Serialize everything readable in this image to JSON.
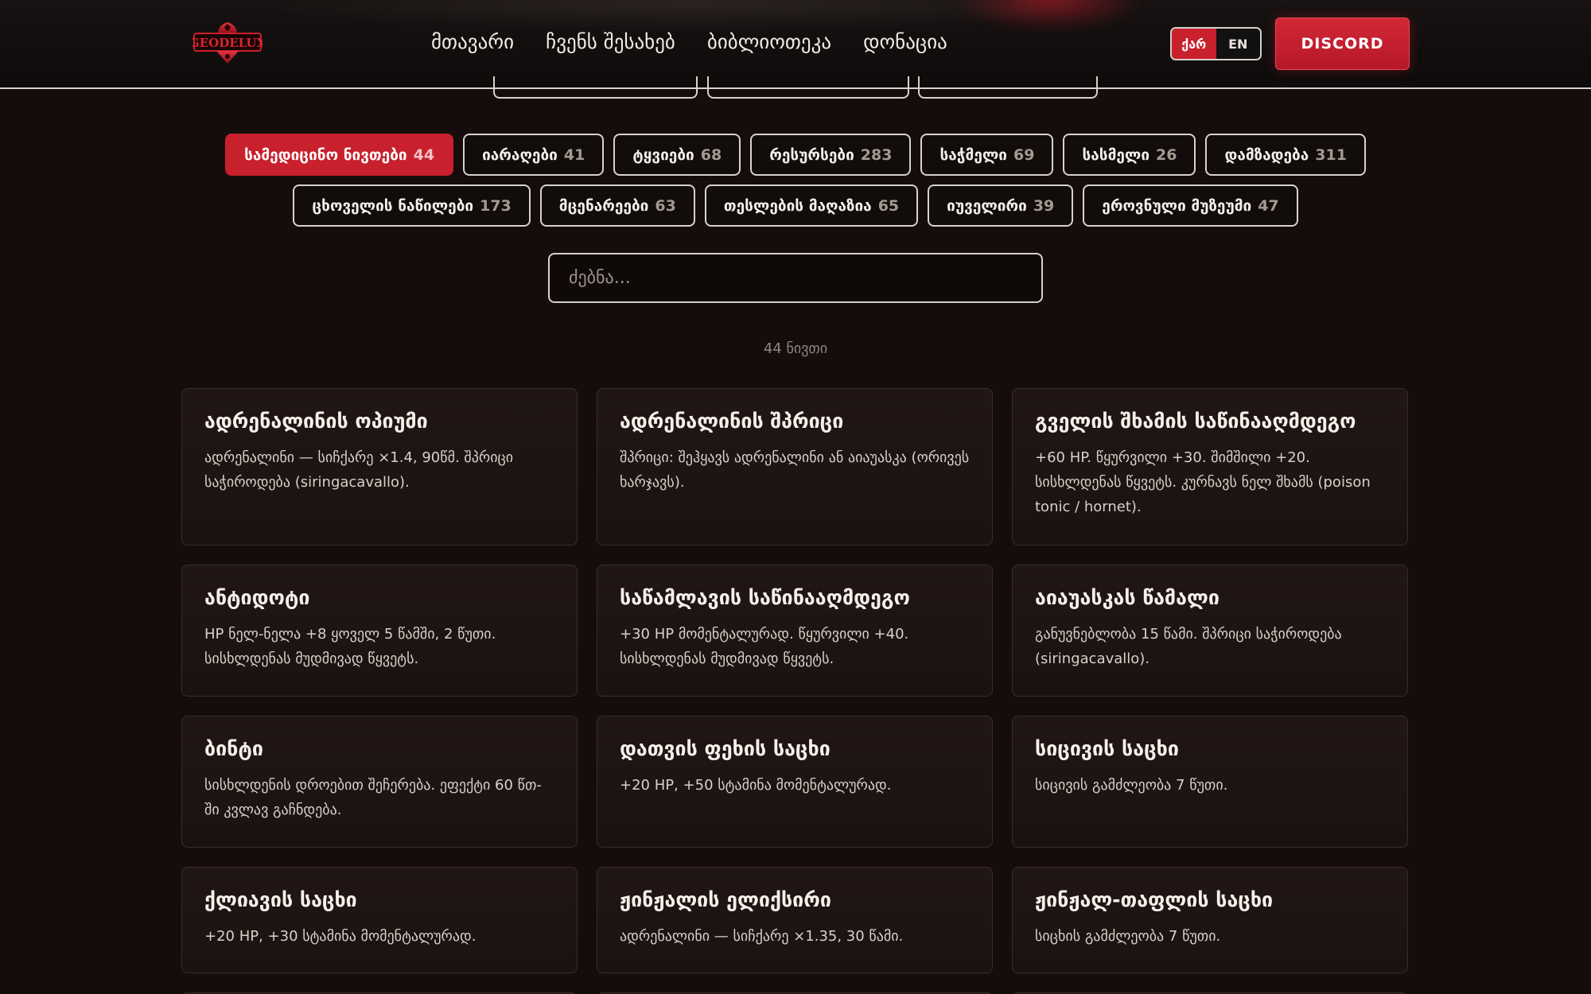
{
  "brand": {
    "logo_text": "GEODELUX"
  },
  "nav": [
    {
      "label": "მთავარი"
    },
    {
      "label": "ჩვენს შესახებ"
    },
    {
      "label": "ბიბლიოთეკა"
    },
    {
      "label": "დონაცია"
    }
  ],
  "lang": {
    "ka": "ქარ",
    "en": "EN",
    "active": "ka"
  },
  "discord_label": "DISCORD",
  "colors": {
    "accent": "#c8202d",
    "background": "#150d0c",
    "card": "#1f1514"
  },
  "categories_row1": [
    {
      "label": "სამედიცინო ნივთები",
      "count": "44",
      "active": true
    },
    {
      "label": "იარაღები",
      "count": "41"
    },
    {
      "label": "ტყვიები",
      "count": "68"
    },
    {
      "label": "რესურსები",
      "count": "283"
    },
    {
      "label": "საჭმელი",
      "count": "69"
    },
    {
      "label": "სასმელი",
      "count": "26"
    },
    {
      "label": "დამზადება",
      "count": "311"
    }
  ],
  "categories_row2": [
    {
      "label": "ცხოველის ნაწილები",
      "count": "173"
    },
    {
      "label": "მცენარეები",
      "count": "63"
    },
    {
      "label": "თესლების მაღაზია",
      "count": "65"
    },
    {
      "label": "იუველირი",
      "count": "39"
    },
    {
      "label": "ეროვნული მუზეუმი",
      "count": "47"
    }
  ],
  "search": {
    "placeholder": "ძებნა..."
  },
  "items_count_label": "44 ნივთი",
  "items": [
    {
      "title": "ადრენალინის ოპიუმი",
      "desc": "ადრენალინი — სიჩქარე ×1.4, 90წმ. შპრიცი საჭიროდება (siringacavallo)."
    },
    {
      "title": "ადრენალინის შპრიცი",
      "desc": "შპრიცი: შეჰყავს ადრენალინი ან აიაუასკა (ორივეს ხარჯავს)."
    },
    {
      "title": "გველის შხამის საწინააღმდეგო",
      "desc": "+60 HP. წყურვილი +30. შიმშილი +20. სისხლდენას წყვეტს. კურნავს ნელ შხამს (poison tonic / hornet)."
    },
    {
      "title": "ანტიდოტი",
      "desc": "HP ნელ-ნელა +8 ყოველ 5 წამში, 2 წუთი. სისხლდენას მუდმივად წყვეტს."
    },
    {
      "title": "საწამლავის საწინააღმდეგო",
      "desc": "+30 HP მომენტალურად. წყურვილი +40. სისხლდენას მუდმივად წყვეტს."
    },
    {
      "title": "აიაუასკას წამალი",
      "desc": "განუვნებლობა 15 წამი. შპრიცი საჭიროდება (siringacavallo)."
    },
    {
      "title": "ბინტი",
      "desc": "სისხლდენის დროებით შეჩერება. ეფექტი 60 წთ-ში კვლავ გაჩნდება."
    },
    {
      "title": "დათვის ფეხის საცხი",
      "desc": "+20 HP, +50 სტამინა მომენტალურად."
    },
    {
      "title": "სიცივის საცხი",
      "desc": "სიცივის გამძლეობა 7 წუთი."
    },
    {
      "title": "ქლიავის საცხი",
      "desc": "+20 HP, +30 სტამინა მომენტალურად."
    },
    {
      "title": "ჟინჟალის ელიქსირი",
      "desc": "ადრენალინი — სიჩქარე ×1.35, 30 წამი."
    },
    {
      "title": "ჟინჟალ-თაფლის საცხი",
      "desc": "სიცხის გამძლეობა 7 წუთი."
    },
    {
      "title": "",
      "desc": ""
    },
    {
      "title": "",
      "desc": ""
    },
    {
      "title": "",
      "desc": ""
    }
  ]
}
